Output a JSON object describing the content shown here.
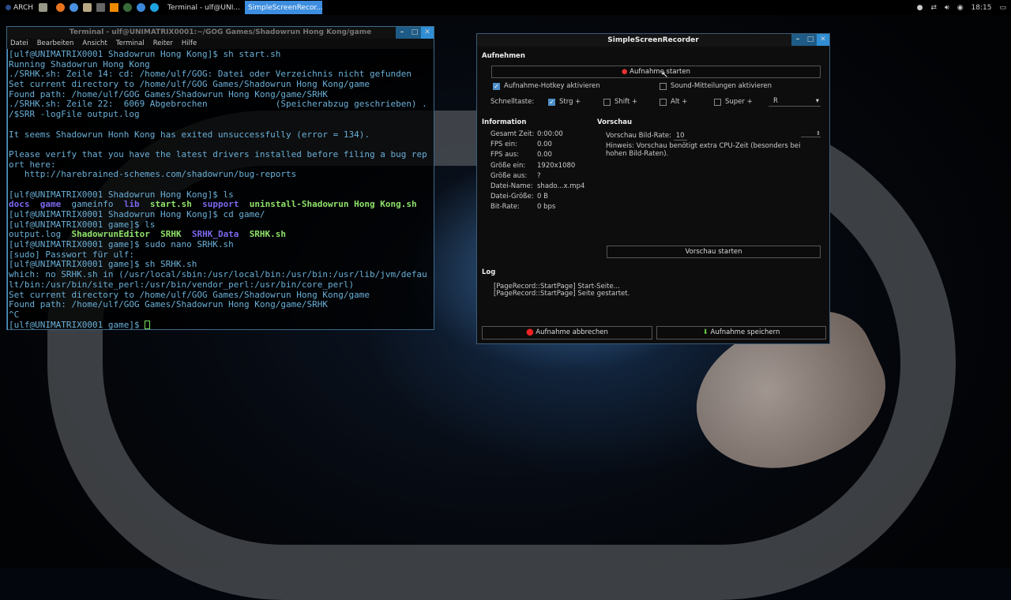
{
  "taskbar": {
    "menu": "ARCH",
    "tasks": [
      {
        "label": "Terminal - ulf@UNI..."
      },
      {
        "label": "SimpleScreenRecor..."
      }
    ],
    "clock": "18:15"
  },
  "terminal": {
    "title": "Terminal - ulf@UNIMATRIX0001:~/GOG Games/Shadowrun Hong Kong/game",
    "menu": [
      "Datei",
      "Bearbeiten",
      "Ansicht",
      "Terminal",
      "Reiter",
      "Hilfe"
    ],
    "lines": [
      [
        {
          "t": "[ulf@UNIMATRIX0001 Shadowrun Hong Kong]$ sh start.sh"
        }
      ],
      [
        {
          "t": "Running Shadowrun Hong Kong"
        }
      ],
      [
        {
          "t": "./SRHK.sh: Zeile 14: cd: /home/ulf/GOG: Datei oder Verzeichnis nicht gefunden"
        }
      ],
      [
        {
          "t": "Set current directory to /home/ulf/GOG Games/Shadowrun Hong Kong/game"
        }
      ],
      [
        {
          "t": "Found path: /home/ulf/GOG Games/Shadowrun Hong Kong/game/SRHK"
        }
      ],
      [
        {
          "t": "./SRHK.sh: Zeile 22:  6069 Abgebrochen             (Speicherabzug geschrieben) ."
        }
      ],
      [
        {
          "t": "/$SRR -logFile output.log"
        }
      ],
      [
        {
          "t": ""
        }
      ],
      [
        {
          "t": "It seems Shadowrun Honh Kong has exited unsuccessfully (error = 134)."
        }
      ],
      [
        {
          "t": ""
        }
      ],
      [
        {
          "t": "Please verify that you have the latest drivers installed before filing a bug rep"
        }
      ],
      [
        {
          "t": "ort here:"
        }
      ],
      [
        {
          "t": "   http://harebrained-schemes.com/shadowrun/bug-reports"
        }
      ],
      [
        {
          "t": ""
        }
      ],
      [
        {
          "t": "[ulf@UNIMATRIX0001 Shadowrun Hong Kong]$ ls"
        }
      ],
      [
        {
          "t": "docs",
          "c": "dir"
        },
        {
          "t": "  "
        },
        {
          "t": "game",
          "c": "dir"
        },
        {
          "t": "  gameinfo  "
        },
        {
          "t": "lib",
          "c": "dir"
        },
        {
          "t": "  "
        },
        {
          "t": "start.sh",
          "c": "exe"
        },
        {
          "t": "  "
        },
        {
          "t": "support",
          "c": "dir"
        },
        {
          "t": "  "
        },
        {
          "t": "uninstall-Shadowrun Hong Kong.sh",
          "c": "exe"
        }
      ],
      [
        {
          "t": "[ulf@UNIMATRIX0001 Shadowrun Hong Kong]$ cd game/"
        }
      ],
      [
        {
          "t": "[ulf@UNIMATRIX0001 game]$ ls"
        }
      ],
      [
        {
          "t": "output.log  "
        },
        {
          "t": "ShadowrunEditor",
          "c": "exe"
        },
        {
          "t": "  "
        },
        {
          "t": "SRHK",
          "c": "exe"
        },
        {
          "t": "  "
        },
        {
          "t": "SRHK_Data",
          "c": "dir"
        },
        {
          "t": "  "
        },
        {
          "t": "SRHK.sh",
          "c": "exe"
        }
      ],
      [
        {
          "t": "[ulf@UNIMATRIX0001 game]$ sudo nano SRHK.sh"
        }
      ],
      [
        {
          "t": "[sudo] Passwort für ulf:"
        }
      ],
      [
        {
          "t": "[ulf@UNIMATRIX0001 game]$ sh SRHK.sh"
        }
      ],
      [
        {
          "t": "which: no SRHK.sh in (/usr/local/sbin:/usr/local/bin:/usr/bin:/usr/lib/jvm/defau"
        }
      ],
      [
        {
          "t": "lt/bin:/usr/bin/site_perl:/usr/bin/vendor_perl:/usr/bin/core_perl)"
        }
      ],
      [
        {
          "t": "Set current directory to /home/ulf/GOG Games/Shadowrun Hong Kong/game"
        }
      ],
      [
        {
          "t": "Found path: /home/ulf/GOG Games/Shadowrun Hong Kong/game/SRHK"
        }
      ],
      [
        {
          "t": "^C"
        }
      ],
      [
        {
          "t": "[ulf@UNIMATRIX0001 game]$ "
        }
      ]
    ]
  },
  "ssr": {
    "title": "SimpleScreenRecorder",
    "record_heading": "Aufnehmen",
    "start_button": "Aufnahme starten",
    "hotkey_enable": "Aufnahme-Hotkey aktivieren",
    "sound_notify": "Sound-Mitteilungen aktivieren",
    "shortcut_label": "Schnelltaste:",
    "mods": [
      "Strg +",
      "Shift +",
      "Alt +",
      "Super +"
    ],
    "key": "R",
    "info_heading": "Information",
    "info": [
      [
        "Gesamt Zeit:",
        "0:00:00"
      ],
      [
        "FPS ein:",
        "0.00"
      ],
      [
        "FPS aus:",
        "0.00"
      ],
      [
        "Größe ein:",
        "1920x1080"
      ],
      [
        "Größe aus:",
        "?"
      ],
      [
        "Datei-Name:",
        "shado...x.mp4"
      ],
      [
        "Datei-Größe:",
        "0 B"
      ],
      [
        "Bit-Rate:",
        "0 bps"
      ]
    ],
    "preview_heading": "Vorschau",
    "preview_rate_label": "Vorschau Bild-Rate:",
    "preview_rate": "10",
    "preview_hint": "Hinweis: Vorschau benötigt extra CPU-Zeit (besonders bei hohen Bild-Raten).",
    "preview_button": "Vorschau starten",
    "log_heading": "Log",
    "log": [
      "[PageRecord::StartPage] Start-Seite...",
      "[PageRecord::StartPage] Seite gestartet."
    ],
    "cancel_button": "Aufnahme abbrechen",
    "save_button": "Aufnahme speichern"
  }
}
